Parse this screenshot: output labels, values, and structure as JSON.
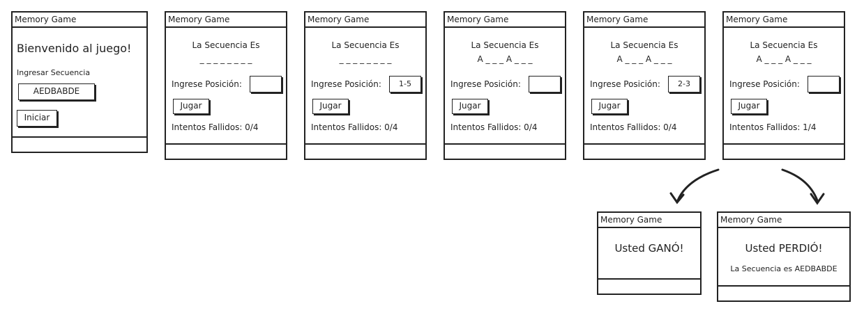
{
  "window_title": "Memory Game",
  "screen_start": {
    "welcome": "Bienvenido al juego!",
    "sequence_label": "Ingresar Secuencia",
    "sequence_value": "AEDBABDE",
    "start_button": "Iniciar"
  },
  "game_screens": [
    {
      "sequence_title": "La Secuencia Es",
      "sequence_mask": "_ _ _ _ _ _ _ _",
      "position_label": "Ingrese Posición:",
      "position_value": "",
      "play_button": "Jugar",
      "failed_attempts": "Intentos Fallidos: 0/4"
    },
    {
      "sequence_title": "La Secuencia Es",
      "sequence_mask": "_ _ _ _ _ _ _ _",
      "position_label": "Ingrese Posición:",
      "position_value": "1-5",
      "play_button": "Jugar",
      "failed_attempts": "Intentos Fallidos: 0/4"
    },
    {
      "sequence_title": "La Secuencia Es",
      "sequence_mask": "A _ _ _ A _ _ _",
      "position_label": "Ingrese Posición:",
      "position_value": "",
      "play_button": "Jugar",
      "failed_attempts": "Intentos Fallidos: 0/4"
    },
    {
      "sequence_title": "La Secuencia Es",
      "sequence_mask": "A _ _ _ A _ _ _",
      "position_label": "Ingrese Posición:",
      "position_value": "2-3",
      "play_button": "Jugar",
      "failed_attempts": "Intentos Fallidos: 0/4"
    },
    {
      "sequence_title": "La Secuencia Es",
      "sequence_mask": "A _ _ _ A _ _ _",
      "position_label": "Ingrese Posición:",
      "position_value": "",
      "play_button": "Jugar",
      "failed_attempts": "Intentos Fallidos: 1/4"
    }
  ],
  "screen_won": {
    "message": "Usted GANÓ!"
  },
  "screen_lost": {
    "message": "Usted PERDIÓ!",
    "sequence_reveal": "La Secuencia es  AEDBABDE"
  }
}
